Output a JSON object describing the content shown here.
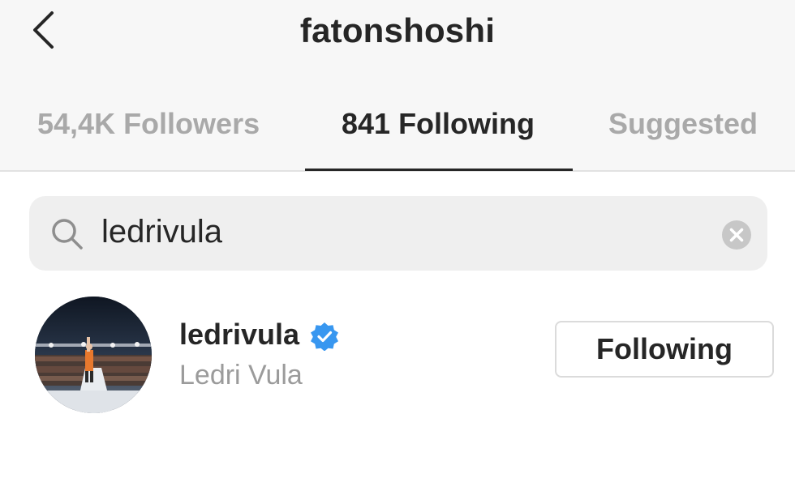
{
  "header": {
    "title": "fatonshoshi",
    "back_icon": "chevron-left-icon"
  },
  "tabs": [
    {
      "label": "54,4K Followers",
      "active": false
    },
    {
      "label": "841 Following",
      "active": true
    },
    {
      "label": "Suggested",
      "active": false
    }
  ],
  "search": {
    "icon": "search-icon",
    "value": "ledrivula",
    "clear_icon": "clear-circle-icon"
  },
  "results": [
    {
      "username": "ledrivula",
      "full_name": "Ledri Vula",
      "verified": true,
      "button_label": "Following"
    }
  ],
  "colors": {
    "header_bg": "#f7f7f7",
    "text_primary": "#262626",
    "text_muted": "#a9a9a9",
    "verified_blue": "#3897f0",
    "search_bg": "#efefef"
  }
}
